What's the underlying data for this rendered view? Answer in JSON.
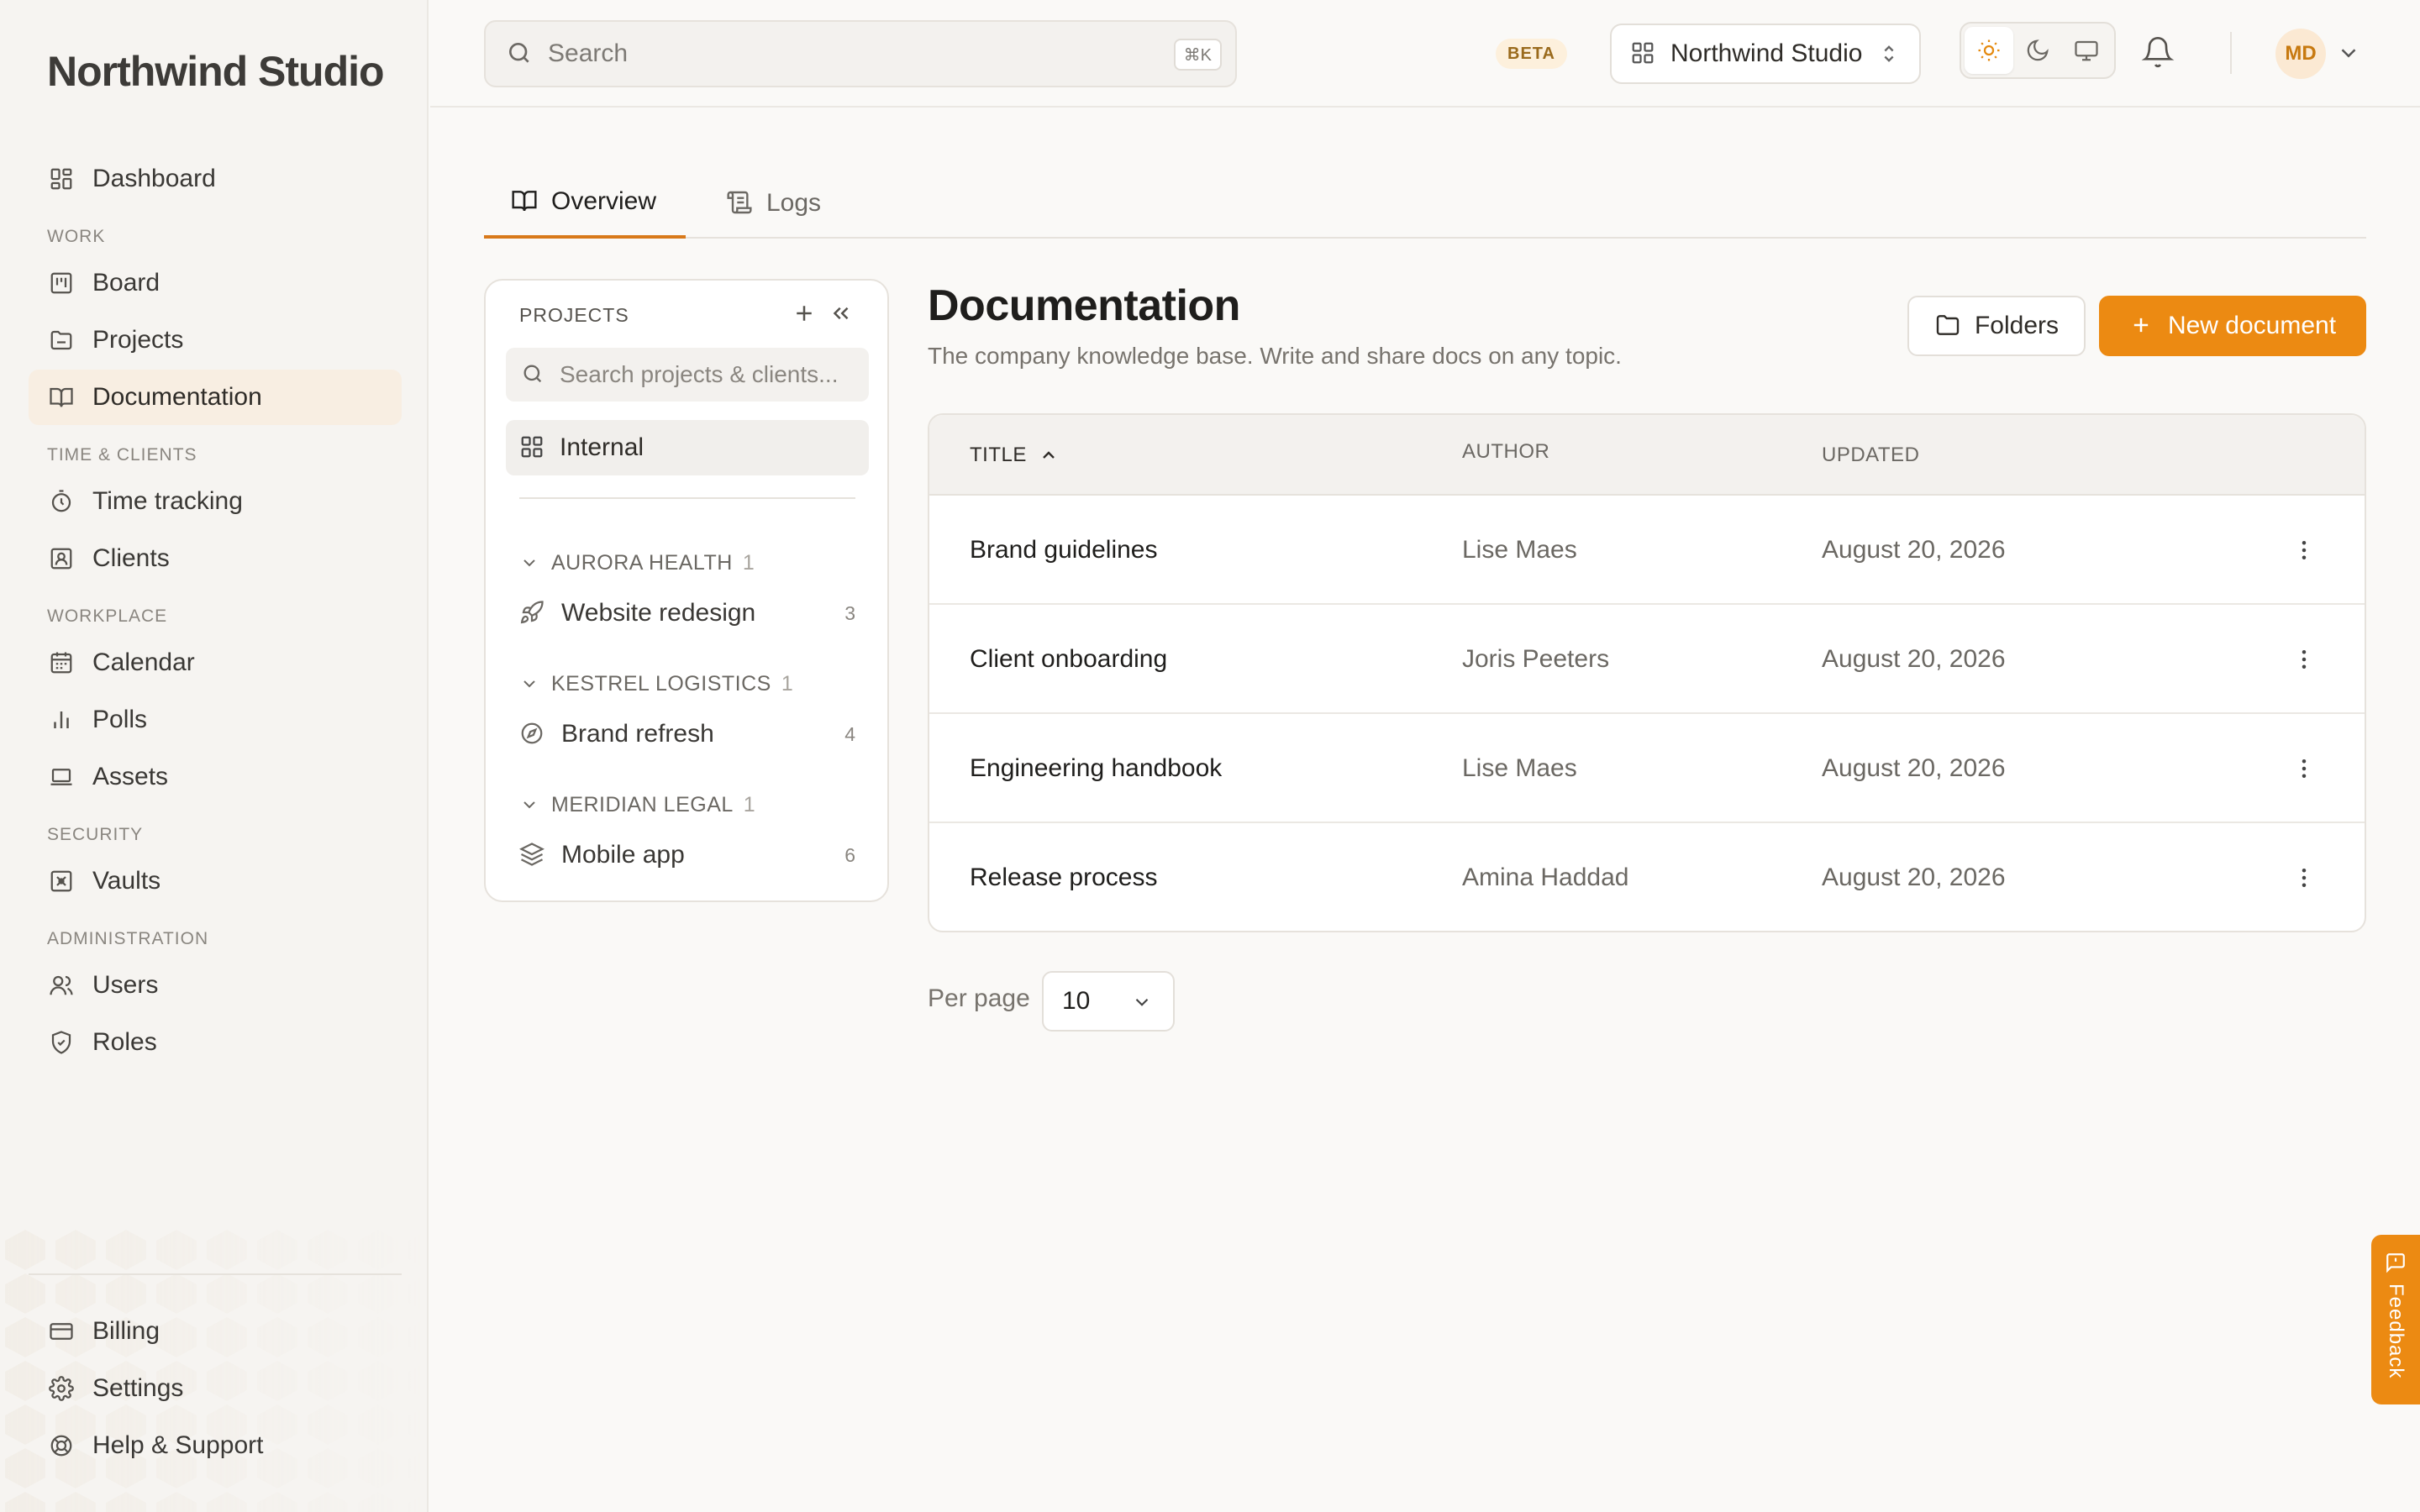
{
  "app": {
    "brand": "Northwind Studio"
  },
  "sidebar": {
    "top": [
      {
        "label": "Dashboard",
        "icon": "dashboard-icon"
      }
    ],
    "sections": [
      {
        "title": "WORK",
        "items": [
          {
            "label": "Board",
            "icon": "board-icon"
          },
          {
            "label": "Projects",
            "icon": "folder-icon"
          },
          {
            "label": "Documentation",
            "icon": "book-icon",
            "active": true
          }
        ]
      },
      {
        "title": "TIME & CLIENTS",
        "items": [
          {
            "label": "Time tracking",
            "icon": "timer-icon"
          },
          {
            "label": "Clients",
            "icon": "contact-icon"
          }
        ]
      },
      {
        "title": "WORKPLACE",
        "items": [
          {
            "label": "Calendar",
            "icon": "calendar-icon"
          },
          {
            "label": "Polls",
            "icon": "bar-chart-icon"
          },
          {
            "label": "Assets",
            "icon": "laptop-icon"
          }
        ]
      },
      {
        "title": "SECURITY",
        "items": [
          {
            "label": "Vaults",
            "icon": "vault-icon"
          }
        ]
      },
      {
        "title": "ADMINISTRATION",
        "items": [
          {
            "label": "Users",
            "icon": "users-icon"
          },
          {
            "label": "Roles",
            "icon": "shield-icon"
          }
        ]
      }
    ],
    "bottom": [
      {
        "label": "Billing",
        "icon": "credit-card-icon"
      },
      {
        "label": "Settings",
        "icon": "gear-icon"
      },
      {
        "label": "Help & Support",
        "icon": "lifebuoy-icon"
      }
    ]
  },
  "topbar": {
    "search_placeholder": "Search",
    "search_shortcut": "⌘K",
    "beta_badge": "BETA",
    "workspace": "Northwind Studio",
    "avatar_initials": "MD"
  },
  "tabs": [
    {
      "label": "Overview",
      "active": true
    },
    {
      "label": "Logs",
      "active": false
    }
  ],
  "projects_panel": {
    "heading": "PROJECTS",
    "search_placeholder": "Search projects & clients...",
    "internal_label": "Internal",
    "groups": [
      {
        "name": "AURORA HEALTH",
        "count": "1",
        "project": "Website redesign",
        "project_count": "3",
        "icon": "rocket-icon"
      },
      {
        "name": "KESTREL LOGISTICS",
        "count": "1",
        "project": "Brand refresh",
        "project_count": "4",
        "icon": "compass-icon"
      },
      {
        "name": "MERIDIAN LEGAL",
        "count": "1",
        "project": "Mobile app",
        "project_count": "6",
        "icon": "layers-icon"
      }
    ]
  },
  "main": {
    "title": "Documentation",
    "subtitle": "The company knowledge base. Write and share docs on any topic.",
    "folders_button": "Folders",
    "new_button": "New document",
    "table": {
      "columns": {
        "title": "TITLE",
        "author": "AUTHOR",
        "updated": "UPDATED"
      },
      "rows": [
        {
          "title": "Brand guidelines",
          "author": "Lise Maes",
          "updated": "August 20, 2026"
        },
        {
          "title": "Client onboarding",
          "author": "Joris Peeters",
          "updated": "August 20, 2026"
        },
        {
          "title": "Engineering handbook",
          "author": "Lise Maes",
          "updated": "August 20, 2026"
        },
        {
          "title": "Release process",
          "author": "Amina Haddad",
          "updated": "August 20, 2026"
        }
      ]
    },
    "per_page_label": "Per page",
    "per_page_value": "10"
  },
  "feedback_label": "Feedback",
  "colors": {
    "accent": "#ec8a12",
    "background": "#faf9f7",
    "sidebar": "#f6f4f1"
  }
}
